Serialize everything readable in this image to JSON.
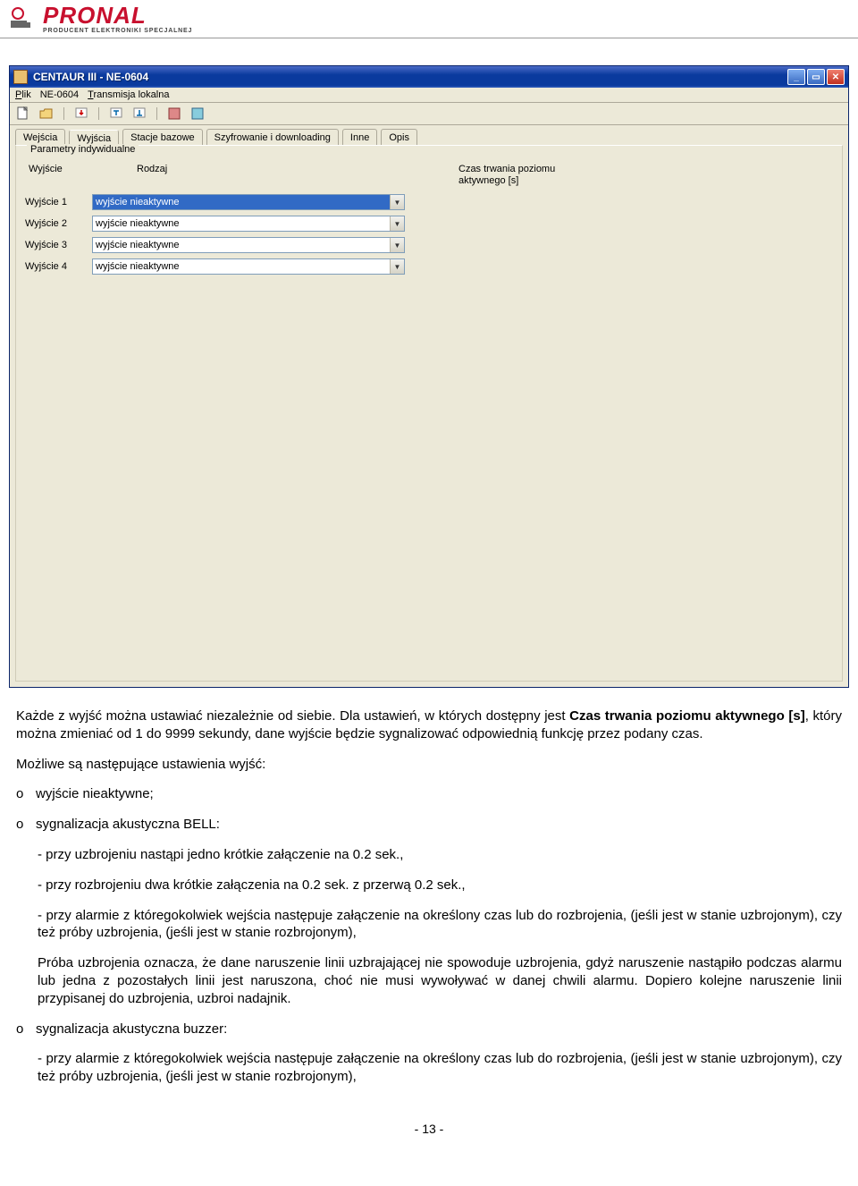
{
  "logo": {
    "main": "PRONAL",
    "sub": "PRODUCENT ELEKTRONIKI SPECJALNEJ"
  },
  "window": {
    "title": "CENTAUR III - NE-0604",
    "menu": {
      "plik": "Plik",
      "ne": "NE-0604",
      "trans": "Transmisja lokalna"
    },
    "tabs": {
      "wejscia": "Wejścia",
      "wyjscia": "Wyjścia",
      "stacje": "Stacje bazowe",
      "szyfr": "Szyfrowanie i downloading",
      "inne": "Inne",
      "opis": "Opis"
    },
    "group_title": "Parametry indywidualne",
    "columns": {
      "wyjscie": "Wyjście",
      "rodzaj": "Rodzaj",
      "czas": "Czas trwania poziomu aktywnego [s]"
    },
    "rows": [
      {
        "label": "Wyjście 1",
        "value": "wyjście nieaktywne",
        "selected": true
      },
      {
        "label": "Wyjście 2",
        "value": "wyjście nieaktywne",
        "selected": false
      },
      {
        "label": "Wyjście 3",
        "value": "wyjście nieaktywne",
        "selected": false
      },
      {
        "label": "Wyjście 4",
        "value": "wyjście nieaktywne",
        "selected": false
      }
    ]
  },
  "doc": {
    "p1a": "Każde z wyjść można ustawiać niezależnie od siebie. Dla ustawień, w których dostępny jest ",
    "p1b": "Czas trwania poziomu aktywnego [s]",
    "p1c": ", który można zmieniać od 1 do 9999 sekundy, dane wyjście będzie sygnalizować odpowiednią funkcję przez podany czas.",
    "p2": "Możliwe są następujące ustawienia wyjść:",
    "li1": "wyjście nieaktywne;",
    "li2": "sygnalizacja akustyczna BELL:",
    "s1": "- przy uzbrojeniu nastąpi jedno krótkie załączenie na 0.2 sek.,",
    "s2": "- przy rozbrojeniu dwa krótkie załączenia na 0.2 sek. z przerwą 0.2 sek.,",
    "s3": "- przy alarmie z któregokolwiek wejścia następuje załączenie na określony czas lub do rozbrojenia, (jeśli jest w stanie uzbrojonym), czy też próby uzbrojenia, (jeśli jest w stanie rozbrojonym),",
    "p3": "Próba uzbrojenia oznacza, że dane naruszenie linii uzbrajającej nie spowoduje uzbrojenia, gdyż naruszenie nastąpiło podczas alarmu lub jedna z pozostałych linii jest naruszona, choć nie musi wywoływać w danej chwili alarmu. Dopiero kolejne naruszenie linii przypisanej do uzbrojenia, uzbroi nadajnik.",
    "li3": "sygnalizacja akustyczna buzzer:",
    "s4": "- przy alarmie z któregokolwiek wejścia następuje załączenie na określony czas lub do rozbrojenia, (jeśli jest w stanie uzbrojonym), czy też próby uzbrojenia, (jeśli jest w stanie rozbrojonym),"
  },
  "page_number": "- 13 -"
}
